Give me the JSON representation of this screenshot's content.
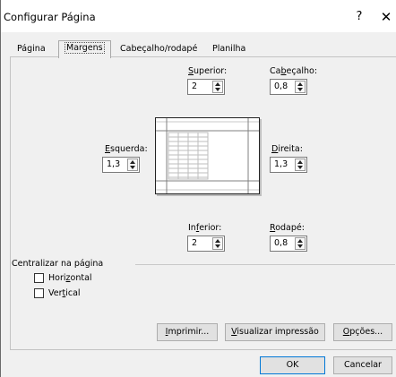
{
  "window": {
    "title": "Configurar Página",
    "help": "?",
    "close": "✕"
  },
  "tabs": [
    {
      "label": "Página"
    },
    {
      "label": "Margens"
    },
    {
      "label": "Cabeçalho/rodapé"
    },
    {
      "label": "Planilha"
    }
  ],
  "margins": {
    "superior": {
      "label_pre": "",
      "label_u": "S",
      "label_post": "uperior:",
      "value": "2"
    },
    "cabecalho": {
      "label_pre": "Ca",
      "label_u": "b",
      "label_post": "eçalho:",
      "value": "0,8"
    },
    "esquerda": {
      "label_pre": "",
      "label_u": "E",
      "label_post": "squerda:",
      "value": "1,3"
    },
    "direita": {
      "label_pre": "",
      "label_u": "D",
      "label_post": "ireita:",
      "value": "1,3"
    },
    "inferior": {
      "label_pre": "In",
      "label_u": "f",
      "label_post": "erior:",
      "value": "2"
    },
    "rodape": {
      "label_pre": "",
      "label_u": "R",
      "label_post": "odapé:",
      "value": "0,8"
    }
  },
  "center": {
    "group_label": "Centralizar na página",
    "horizontal": {
      "label_pre": "Hori",
      "label_u": "z",
      "label_post": "ontal",
      "checked": false
    },
    "vertical": {
      "label_pre": "Ver",
      "label_u": "t",
      "label_post": "ical",
      "checked": false
    }
  },
  "buttons": {
    "imprimir": {
      "label_pre": "",
      "label_u": "I",
      "label_post": "mprimir..."
    },
    "visualizar": {
      "label_pre": "",
      "label_u": "V",
      "label_post": "isualizar impressão"
    },
    "opcoes": {
      "label_pre": "",
      "label_u": "O",
      "label_post": "pções..."
    },
    "ok": "OK",
    "cancelar": "Cancelar"
  },
  "colors": {
    "primary_border": "#0078d7",
    "dialog_bg": "#f0f0f0"
  }
}
